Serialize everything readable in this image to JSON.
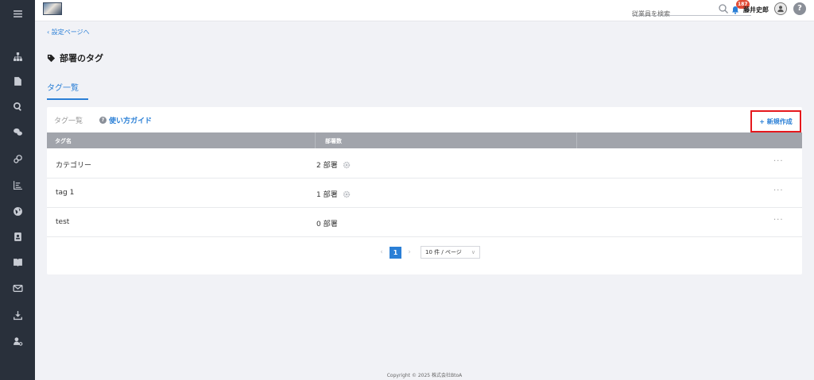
{
  "topbar": {
    "search_placeholder": "従業員を検索",
    "notification_count": "187",
    "username": "藤井史郎",
    "help_label": "?"
  },
  "nav": {
    "back_label": "‹ 設定ページへ",
    "page_title": "部署のタグ",
    "tab_label": "タグ一覧"
  },
  "card": {
    "title": "タグ一覧",
    "guide_label": "使い方ガイド",
    "new_button_label": "+ 新規作成",
    "columns": [
      "タグ名",
      "部署数"
    ],
    "rows": [
      {
        "name": "カテゴリー",
        "count": "2 部署",
        "has_gear": true
      },
      {
        "name": "tag 1",
        "count": "1 部署",
        "has_gear": true
      },
      {
        "name": "test",
        "count": "0 部署",
        "has_gear": false
      }
    ],
    "more_label": "···"
  },
  "pagination": {
    "prev": "‹",
    "current_page": "1",
    "next": "›",
    "page_size": "10 件 / ページ"
  },
  "footer": {
    "copyright": "Copyright © 2025 株式会社BtoA"
  },
  "colors": {
    "sidebar": "#29303b",
    "accent": "#2a7fd6",
    "highlight_border": "#e5181c",
    "badge": "#e04b35",
    "table_header": "#a1a4ab"
  }
}
